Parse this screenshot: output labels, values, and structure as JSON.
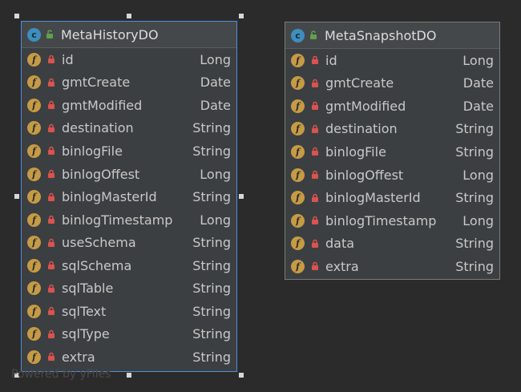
{
  "classes": [
    {
      "title": "MetaHistoryDO",
      "icon": "c",
      "fields": [
        {
          "name": "id",
          "type": "Long"
        },
        {
          "name": "gmtCreate",
          "type": "Date"
        },
        {
          "name": "gmtModified",
          "type": "Date"
        },
        {
          "name": "destination",
          "type": "String"
        },
        {
          "name": "binlogFile",
          "type": "String"
        },
        {
          "name": "binlogOffest",
          "type": "Long"
        },
        {
          "name": "binlogMasterId",
          "type": "String"
        },
        {
          "name": "binlogTimestamp",
          "type": "Long"
        },
        {
          "name": "useSchema",
          "type": "String"
        },
        {
          "name": "sqlSchema",
          "type": "String"
        },
        {
          "name": "sqlTable",
          "type": "String"
        },
        {
          "name": "sqlText",
          "type": "String"
        },
        {
          "name": "sqlType",
          "type": "String"
        },
        {
          "name": "extra",
          "type": "String"
        }
      ]
    },
    {
      "title": "MetaSnapshotDO",
      "icon": "c",
      "fields": [
        {
          "name": "id",
          "type": "Long"
        },
        {
          "name": "gmtCreate",
          "type": "Date"
        },
        {
          "name": "gmtModified",
          "type": "Date"
        },
        {
          "name": "destination",
          "type": "String"
        },
        {
          "name": "binlogFile",
          "type": "String"
        },
        {
          "name": "binlogOffest",
          "type": "Long"
        },
        {
          "name": "binlogMasterId",
          "type": "String"
        },
        {
          "name": "binlogTimestamp",
          "type": "Long"
        },
        {
          "name": "data",
          "type": "String"
        },
        {
          "name": "extra",
          "type": "String"
        }
      ]
    }
  ],
  "field_icon_letter": "f",
  "watermark": "Powered by yFiles",
  "colors": {
    "background": "#2b2b2b",
    "class_icon": "#3d8ebf",
    "field_icon": "#c59b45",
    "lock": "#d9534f",
    "selection": "#4e8fd6"
  }
}
